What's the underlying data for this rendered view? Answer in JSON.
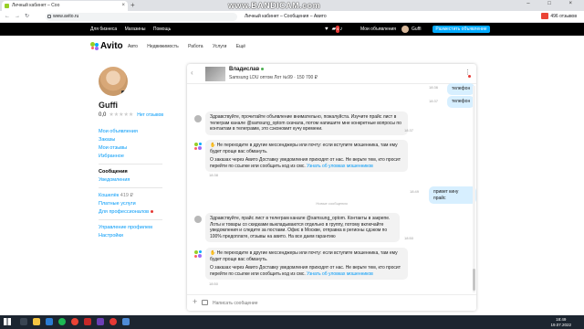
{
  "browser": {
    "tab_title": "Личный кабинет – Соо",
    "tab_close": "×",
    "new_tab": "+",
    "url": "www.avito.ru",
    "page_title": "Личный кабинет – Сообщения – Авито",
    "watermark": "www.BANDICAM.com",
    "reviews_ext": "496 отзывов",
    "window_buttons": "–  □  ×"
  },
  "topbar": {
    "links": [
      "Для бизнеса",
      "Магазины",
      "Помощь"
    ],
    "badge": "6",
    "my_ads": "Мои объявления",
    "username": "Guffi",
    "place_ad": "Разместить объявление"
  },
  "header": {
    "logo": "Avito",
    "categories": [
      "Авто",
      "Недвижимость",
      "Работа",
      "Услуги",
      "Ещё"
    ]
  },
  "profile": {
    "name": "Guffi",
    "rating": "0,0",
    "stars": "★★★★★",
    "reviews": "Нет отзывов",
    "menu": {
      "my_ads": "Мои объявления",
      "orders": "Заказы",
      "my_reviews": "Мои отзывы",
      "favorites": "Избранное",
      "messages": "Сообщения",
      "notifications": "Уведомления",
      "wallet": "Кошелёк",
      "wallet_amount": "419 ₽",
      "paid_services": "Платные услуги",
      "for_pros": "Для профессионалов",
      "profile_manage": "Управление профилем",
      "settings": "Настройки"
    }
  },
  "chat": {
    "contact_name": "Владислав",
    "ad_title": "Samsung LDU оптом Лот №99 · 150 700 ₽",
    "divider": "Новые сообщения",
    "messages": [
      {
        "text": "телефон",
        "time": "18:36"
      },
      {
        "text": "телефон",
        "time": "18:37"
      },
      {
        "text": "Здравствуйте, прочитайте объявление внимательно, пожалуйста. Изучите прайс лист в телеграм канале @samsung_optom скачала, потом напишите мне конкретные вопросы по контактам в телеграмм, это сэкономит кучу времени.",
        "time": "18:37"
      },
      {
        "warn": "Не переходите в другие мессенджеры или почту: если вступите мошенника, там ему будет проще вас обмануть.",
        "text": "О заказах через Авито Доставку уведомления приходят от нас. Не верьте тем, кто просит перейти по ссылке или сообщить код из смс.",
        "link": "Узнать об уловках мошенников",
        "time": "18:38"
      },
      {
        "text": "привет кину прайс",
        "time": "18:49"
      },
      {
        "text": "Здравствуйте, прайс лист в телеграм канале @samsung_optom. Контакты в закрепе. Лоты и товары со скидками выкладываются отдельно в группу, потому включайте уведомления и следите за постами. Офис в Москве, отправка в регионы сдэком по 100% предоплате, отзывы на авито. На все даем гарантию",
        "time": "18:50"
      },
      {
        "warn": "Не переходите в другие мессенджеры или почту: если вступите мошенника, там ему будет проще вас обмануть.",
        "text": "О заказах через Авито Доставку уведомления приходят от нас. Не верьте тем, кто просит перейти по ссылке или сообщить код из смс.",
        "link": "Узнать об уловках мошенников",
        "time": "18:50"
      }
    ],
    "composer_placeholder": "Написать сообщение"
  },
  "taskbar": {
    "time": "18:49",
    "date": "19.07.2022"
  },
  "colors": {
    "accent": "#00aaff",
    "link": "#0099f7",
    "outgoing_bubble": "#d7efff",
    "incoming_bubble": "#f2f2f2"
  }
}
